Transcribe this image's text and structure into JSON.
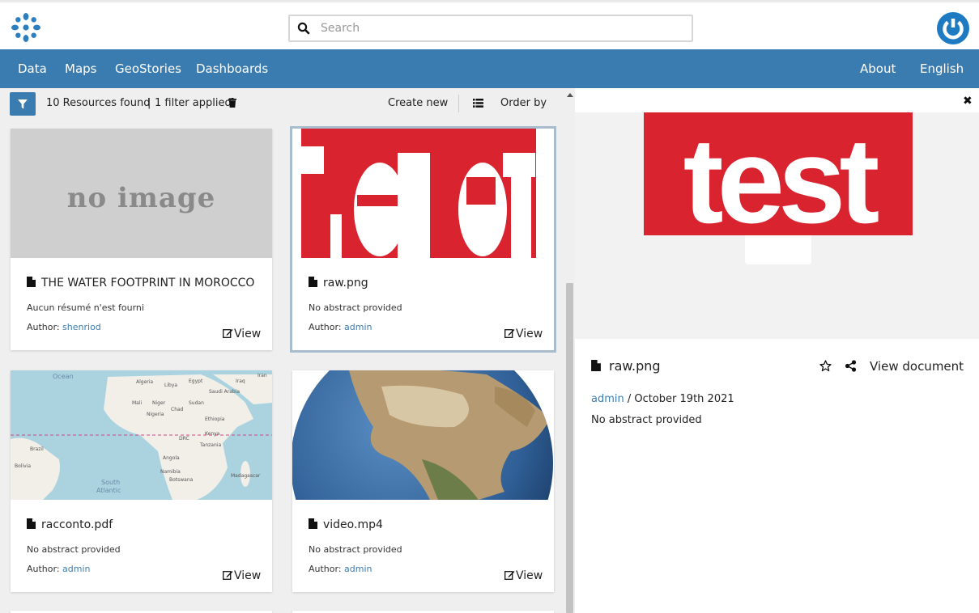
{
  "header": {
    "search_placeholder": "Search"
  },
  "nav": {
    "left": [
      {
        "label": "Data"
      },
      {
        "label": "Maps"
      },
      {
        "label": "GeoStories"
      },
      {
        "label": "Dashboards"
      }
    ],
    "right": [
      {
        "label": "About"
      },
      {
        "label": "English"
      }
    ]
  },
  "toolbar": {
    "resources_found": "10 Resources found",
    "separator": "|",
    "filters_applied": "1 filter applied",
    "create_new": "Create new",
    "order_by": "Order by"
  },
  "cards": [
    {
      "title": "THE WATER FOOTPRINT IN MOROCCO",
      "abstract": "Aucun résumé n'est fourni",
      "author_label": "Author:",
      "author": "shenriod",
      "view_label": "View",
      "thumb_text": "no image"
    },
    {
      "title": "raw.png",
      "abstract": "No abstract provided",
      "author_label": "Author:",
      "author": "admin",
      "view_label": "View"
    },
    {
      "title": "racconto.pdf",
      "abstract": "No abstract provided",
      "author_label": "Author:",
      "author": "admin",
      "view_label": "View",
      "map_labels": [
        "Ocean",
        "Algeria",
        "Libya",
        "Egypt",
        "Iraq",
        "Iran",
        "Saudi Arabia",
        "Mali",
        "Niger",
        "Sudan",
        "Chad",
        "Nigeria",
        "Ethiopia",
        "DRC",
        "Kenya",
        "Tanzania",
        "Brazil",
        "Angola",
        "Bolivia",
        "Namibia",
        "Madagascar",
        "Botswana",
        "South",
        "Atlantic"
      ]
    },
    {
      "title": "video.mp4",
      "abstract": "No abstract provided",
      "author_label": "Author:",
      "author": "admin",
      "view_label": "View"
    }
  ],
  "detail": {
    "title": "raw.png",
    "view_document": "View document",
    "author": "admin",
    "date": " / October 19th 2021",
    "abstract": "No abstract provided",
    "close": "✖",
    "preview_text": "test"
  },
  "colors": {
    "navbar": "#3b7cb0",
    "link": "#3b7cb0",
    "brand_red": "#d9232e",
    "user_button": "#1e7bc2"
  }
}
